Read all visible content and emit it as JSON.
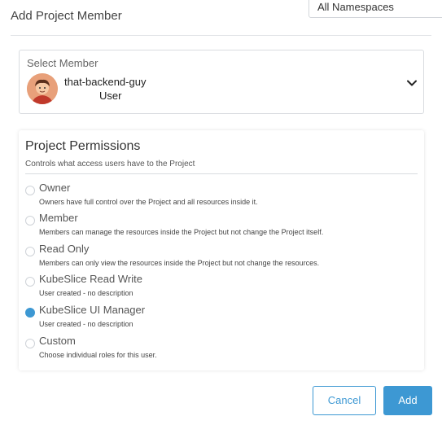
{
  "background": {
    "namespace_filter": "All Namespaces"
  },
  "modal": {
    "title": "Add Project Member",
    "member_select": {
      "label": "Select Member",
      "selected_name": "that-backend-guy",
      "selected_role": "User"
    },
    "permissions": {
      "title": "Project Permissions",
      "subtitle": "Controls what access users have to the Project",
      "selected": "KubeSlice UI Manager",
      "options": [
        {
          "label": "Owner",
          "desc": "Owners have full control over the Project and all resources inside it."
        },
        {
          "label": "Member",
          "desc": "Members can manage the resources inside the Project but not change the Project itself."
        },
        {
          "label": "Read Only",
          "desc": "Members can only view the resources inside the Project but not change the resources."
        },
        {
          "label": "KubeSlice Read Write",
          "desc": "User created - no description"
        },
        {
          "label": "KubeSlice UI Manager",
          "desc": "User created - no description"
        },
        {
          "label": "Custom",
          "desc": "Choose individual roles for this user."
        }
      ]
    },
    "buttons": {
      "cancel": "Cancel",
      "add": "Add"
    }
  },
  "colors": {
    "accent": "#3d98d3"
  }
}
